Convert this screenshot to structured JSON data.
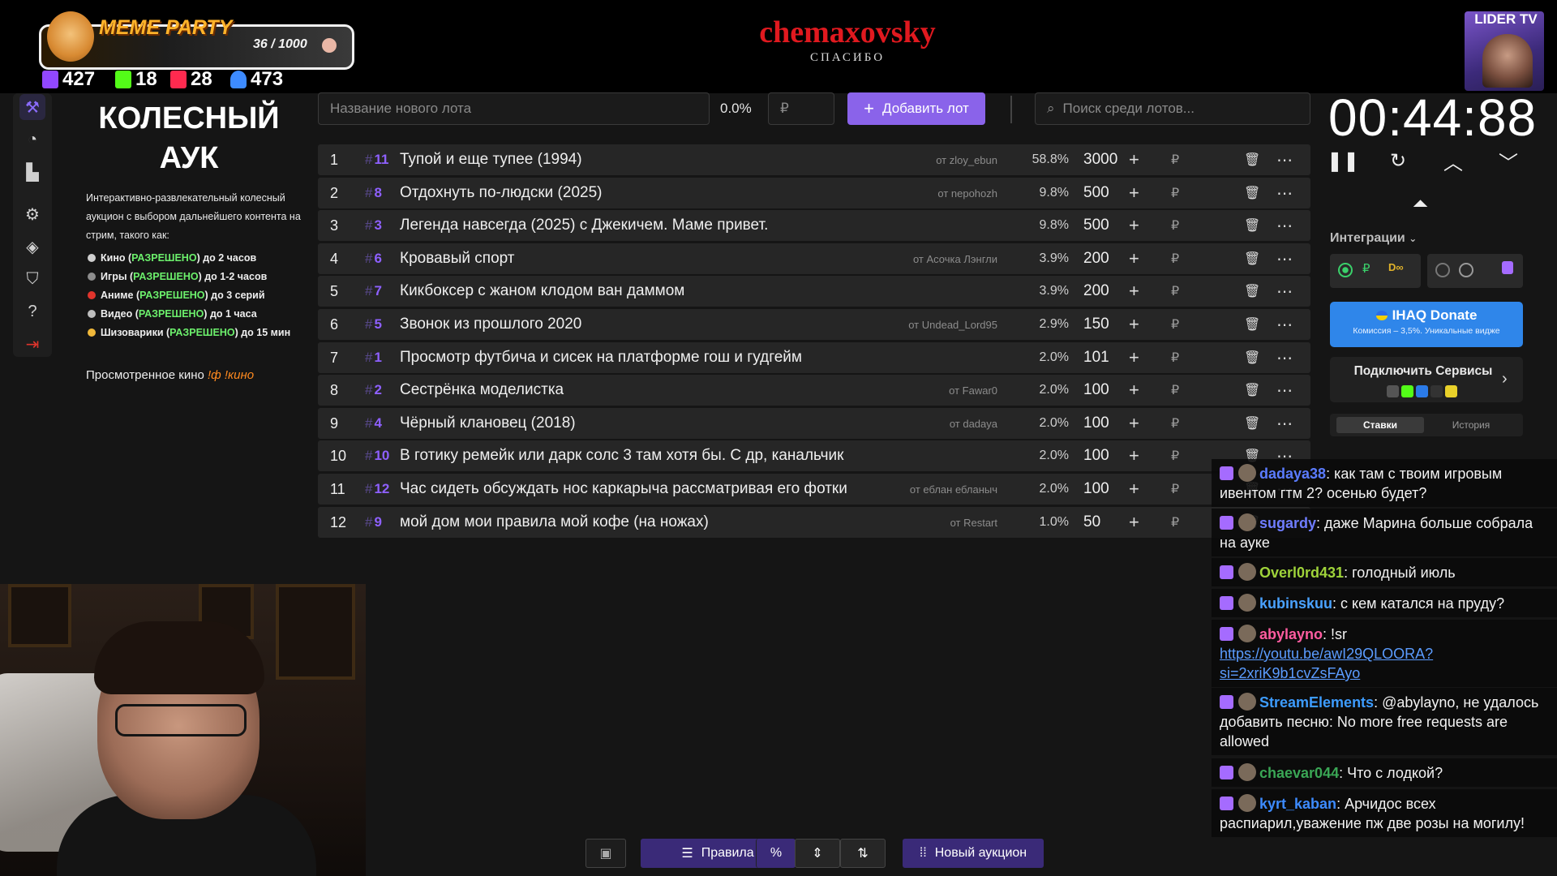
{
  "overlay": {
    "meme_title": "MEME PARTY",
    "meme_count": "36 / 1000",
    "stats": [
      {
        "icon": "twitch-icon",
        "value": "427",
        "color": "#9147ff"
      },
      {
        "icon": "kick-icon",
        "value": "18",
        "color": "#53fc18"
      },
      {
        "icon": "vk-live-icon",
        "value": "28",
        "color": "#ff2a4f"
      },
      {
        "icon": "viewers-icon",
        "value": "473",
        "color": "#3d8bff"
      }
    ],
    "channel": "chemaxovsky",
    "thanks": "СПАСИБО",
    "lider_tv": "LIDER TV"
  },
  "sidebar": {
    "icons": [
      "gavel-icon",
      "pie-chart-icon",
      "bar-chart-icon",
      "gear-icon",
      "layers-icon",
      "shield-icon",
      "help-icon",
      "logout-icon"
    ]
  },
  "auction": {
    "title_line1": "КОЛЕСНЫЙ",
    "title_line2": "АУК",
    "description": "Интерактивно-развлекательный колесный аукцион с выбором дальнейшего контента на стрим, такого как:",
    "rules": [
      {
        "label": "Кино",
        "status": "РАЗРЕШЕНО",
        "limit": "до 2 часов",
        "color": "#cfcfcf"
      },
      {
        "label": "Игры",
        "status": "РАЗРЕШЕНО",
        "limit": "до 1-2 часов",
        "color": "#8d8d8d"
      },
      {
        "label": "Аниме",
        "status": "РАЗРЕШЕНО",
        "limit": "до 3 серий",
        "color": "#e0342c"
      },
      {
        "label": "Видео",
        "status": "РАЗРЕШЕНО",
        "limit": "до 1 часа",
        "color": "#bdbdbd"
      },
      {
        "label": "Шизоварики",
        "status": "РАЗРЕШЕНО",
        "limit": "до 15 мин",
        "color": "#f0b83a"
      }
    ],
    "watched_label": "Просмотренное кино",
    "watched_cmd": "!ф !кино"
  },
  "add_lot": {
    "name_placeholder": "Название нового лота",
    "percent": "0.0%",
    "currency_placeholder": "₽",
    "add_button": "Добавить лот",
    "search_placeholder": "Поиск среди лотов..."
  },
  "lots": [
    {
      "n": "1",
      "rank": "11",
      "name": "Тупой и еще тупее (1994)",
      "author": "от zloy_ebun",
      "pct": "58.8%",
      "amount": "3000"
    },
    {
      "n": "2",
      "rank": "8",
      "name": "Отдохнуть по-людски (2025)",
      "author": "от nepohozh",
      "pct": "9.8%",
      "amount": "500"
    },
    {
      "n": "3",
      "rank": "3",
      "name": "Легенда навсегда (2025) с Джекичем. Маме привет.",
      "author": "",
      "pct": "9.8%",
      "amount": "500"
    },
    {
      "n": "4",
      "rank": "6",
      "name": "Кровавый спорт",
      "author": "от Асочка Лэнгли",
      "pct": "3.9%",
      "amount": "200"
    },
    {
      "n": "5",
      "rank": "7",
      "name": "Кикбоксер с жаном клодом ван даммом",
      "author": "",
      "pct": "3.9%",
      "amount": "200"
    },
    {
      "n": "6",
      "rank": "5",
      "name": "Звонок из прошлого 2020",
      "author": "от Undead_Lord95",
      "pct": "2.9%",
      "amount": "150"
    },
    {
      "n": "7",
      "rank": "1",
      "name": "Просмотр футбича и сисек на платформе гош и гудгейм",
      "author": "",
      "pct": "2.0%",
      "amount": "101"
    },
    {
      "n": "8",
      "rank": "2",
      "name": "Сестрёнка моделистка",
      "author": "от Fawar0",
      "pct": "2.0%",
      "amount": "100"
    },
    {
      "n": "9",
      "rank": "4",
      "name": "Чёрный клановец (2018)",
      "author": "от dadaya",
      "pct": "2.0%",
      "amount": "100"
    },
    {
      "n": "10",
      "rank": "10",
      "name": "В готику ремейк или дарк солс 3 там хотя бы. С др, канальчик",
      "author": "",
      "pct": "2.0%",
      "amount": "100"
    },
    {
      "n": "11",
      "rank": "12",
      "name": "Час сидеть обсуждать нос каркарыча рассматривая его фотки",
      "author": "от еблан ебланыч",
      "pct": "2.0%",
      "amount": "100"
    },
    {
      "n": "12",
      "rank": "9",
      "name": "мой дом мои правила мой кофе (на ножах)",
      "author": "от Restart",
      "pct": "1.0%",
      "amount": "50"
    }
  ],
  "lot_currency": "₽",
  "timer": {
    "value": "00:44:88"
  },
  "integrations": {
    "title": "Интеграции",
    "donate_title": "IHAQ Donate",
    "donate_sub": "Комиссия – 3,5%. Уникальные видже",
    "connect_label": "Подключить Сервисы",
    "tab_bets": "Ставки",
    "tab_history": "История"
  },
  "chat": [
    {
      "user": "dadaya38",
      "color": "#5b7cff",
      "text": ": как там с твоим игровым ивентом гтм 2? осенью будет?",
      "link": ""
    },
    {
      "user": "sugardy",
      "color": "#6f7dff",
      "text": ": даже Марина больше собрала на ауке",
      "link": ""
    },
    {
      "user": "Overl0rd431",
      "color": "#9fd33a",
      "text": ": голодный июль",
      "link": ""
    },
    {
      "user": "kubinskuu",
      "color": "#4aa2ff",
      "text": ": с кем катался на пруду?",
      "link": ""
    },
    {
      "user": "abylayno",
      "color": "#ff5ca0",
      "text": ": !sr",
      "link": "https://youtu.be/awI29QLOORA?si=2xriK9b1cvZsFAyo"
    },
    {
      "user": "StreamElements",
      "color": "#3d9cff",
      "text": ": @abylayno, не удалось добавить песню: No more free requests are allowed",
      "link": ""
    },
    {
      "user": "chaevar044",
      "color": "#3aa655",
      "text": ": Что с лодкой?",
      "link": ""
    },
    {
      "user": "kyrt_kaban",
      "color": "#3d8bff",
      "text": ": Арчидос всех распиарил,уважение пж две розы на могилу!",
      "link": ""
    }
  ],
  "toolbar": {
    "rules": "Правила",
    "percent": "%",
    "new_auction": "Новый аукцион"
  }
}
